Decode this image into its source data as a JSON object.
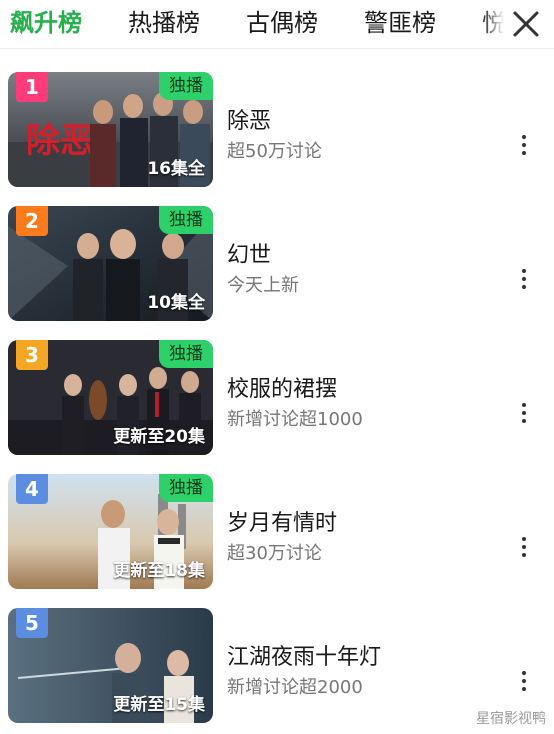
{
  "tabs": [
    {
      "label": "飙升榜",
      "active": true
    },
    {
      "label": "热播榜",
      "active": false
    },
    {
      "label": "古偶榜",
      "active": false
    },
    {
      "label": "警匪榜",
      "active": false
    },
    {
      "label": "悦",
      "active": false
    }
  ],
  "close_icon": "close-icon",
  "items": [
    {
      "rank": "1",
      "title": "除恶",
      "subtitle": "超50万讨论",
      "badge": "独播",
      "episodes": "16集全",
      "rank_color": "#ff3b7a"
    },
    {
      "rank": "2",
      "title": "幻世",
      "subtitle": "今天上新",
      "badge": "独播",
      "episodes": "10集全",
      "rank_color": "#ff7a1a"
    },
    {
      "rank": "3",
      "title": "校服的裙摆",
      "subtitle": "新增讨论超1000",
      "badge": "独播",
      "episodes": "更新至20集",
      "rank_color": "#f5a623"
    },
    {
      "rank": "4",
      "title": "岁月有情时",
      "subtitle": "超30万讨论",
      "badge": "独播",
      "episodes": "更新至18集",
      "rank_color": "#5b8de0"
    },
    {
      "rank": "5",
      "title": "江湖夜雨十年灯",
      "subtitle": "新增讨论超2000",
      "badge": "",
      "episodes": "更新至15集",
      "rank_color": "#5b8de0"
    }
  ],
  "more_icon": "more-vertical-icon",
  "watermark": "星宿影视鸭",
  "colors": {
    "accent": "#26b04b",
    "badge_bg": "#2ed06a"
  }
}
